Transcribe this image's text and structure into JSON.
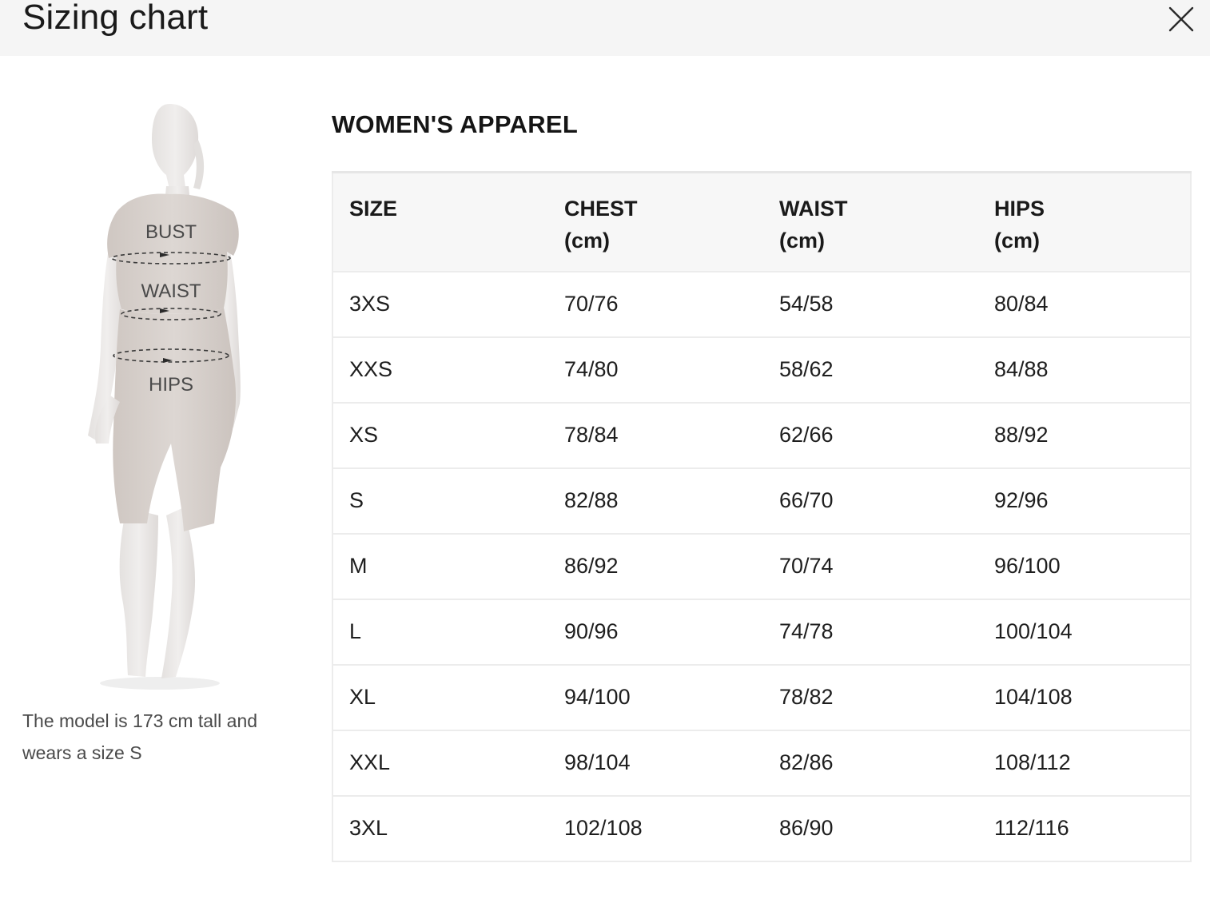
{
  "header": {
    "title": "Sizing chart",
    "close_icon": "close-icon"
  },
  "figure": {
    "labels": [
      "BUST",
      "WAIST",
      "HIPS"
    ],
    "note": "The model is 173 cm tall and wears a size S"
  },
  "section": {
    "title": "WOMEN'S APPAREL"
  },
  "table": {
    "headers": [
      {
        "label": "SIZE",
        "unit": ""
      },
      {
        "label": "CHEST",
        "unit": "(cm)"
      },
      {
        "label": "WAIST",
        "unit": "(cm)"
      },
      {
        "label": "HIPS",
        "unit": "(cm)"
      }
    ],
    "rows": [
      [
        "3XS",
        "70/76",
        "54/58",
        "80/84"
      ],
      [
        "XXS",
        "74/80",
        "58/62",
        "84/88"
      ],
      [
        "XS",
        "78/84",
        "62/66",
        "88/92"
      ],
      [
        "S",
        "82/88",
        "66/70",
        "92/96"
      ],
      [
        "M",
        "86/92",
        "70/74",
        "96/100"
      ],
      [
        "L",
        "90/96",
        "74/78",
        "100/104"
      ],
      [
        "XL",
        "94/100",
        "78/82",
        "104/108"
      ],
      [
        "XXL",
        "98/104",
        "82/86",
        "108/112"
      ],
      [
        "3XL",
        "102/108",
        "86/90",
        "112/116"
      ]
    ]
  },
  "colors": {
    "header_bg": "#f5f5f5",
    "table_header_bg": "#f7f7f7",
    "border": "#ececec",
    "figure_body": "#ebe8e6",
    "figure_clothing": "#d8d1cc"
  }
}
